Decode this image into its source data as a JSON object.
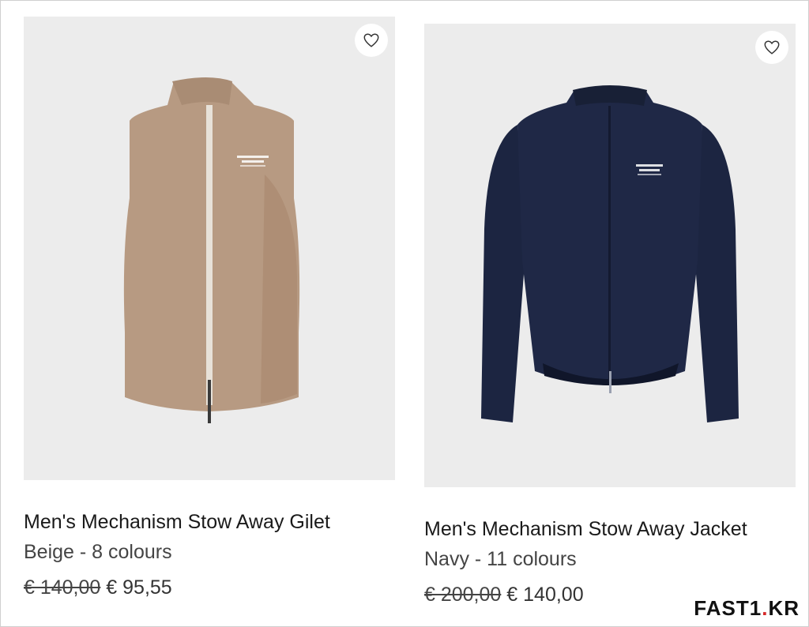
{
  "products": [
    {
      "title": "Men's Mechanism Stow Away Gilet",
      "colour_info": "Beige - 8 colours",
      "old_price": "€ 140,00",
      "new_price": "€ 95,55",
      "garment_color": "#b79a82",
      "image_bg": "#ececec",
      "wishlist_icon": "heart-outline-icon"
    },
    {
      "title": "Men's Mechanism Stow Away Jacket",
      "colour_info": "Navy - 11 colours",
      "old_price": "€ 200,00",
      "new_price": "€ 140,00",
      "garment_color": "#1c2541",
      "image_bg": "#ececec",
      "wishlist_icon": "heart-outline-icon"
    }
  ],
  "watermark": {
    "text_main": "FAST1",
    "text_dot": ".",
    "text_suffix": "KR"
  }
}
